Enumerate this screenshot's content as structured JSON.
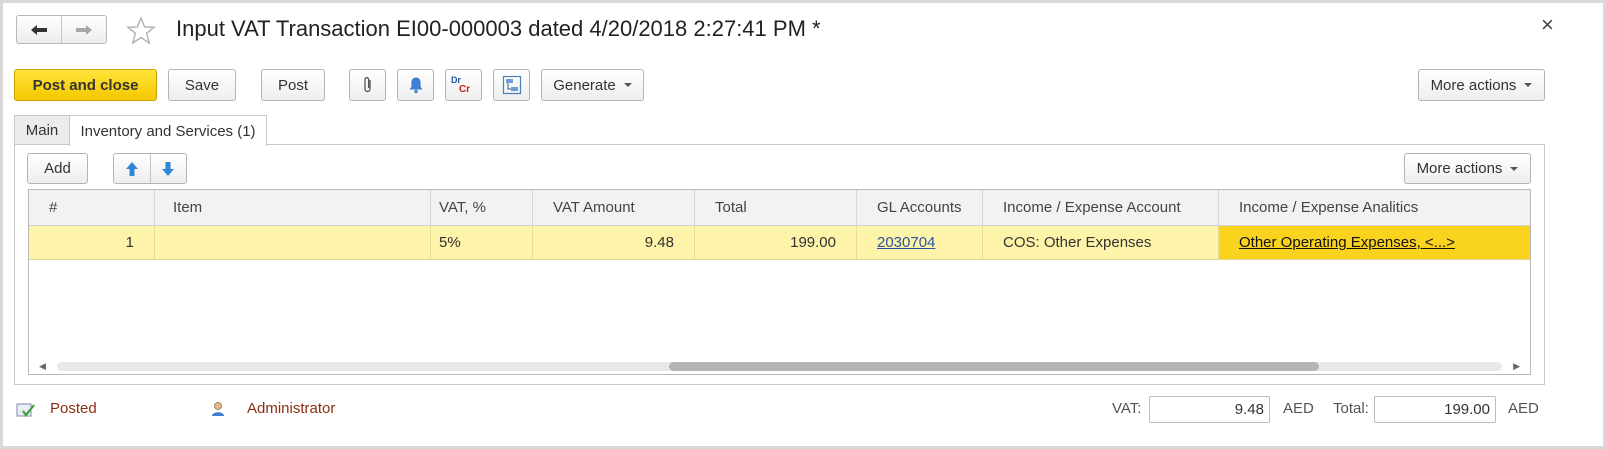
{
  "window": {
    "title": "Input VAT Transaction EI00-000003 dated 4/20/2018 2:27:41 PM *",
    "close_symbol": "×"
  },
  "toolbar": {
    "post_and_close": "Post and close",
    "save": "Save",
    "post": "Post",
    "generate": "Generate",
    "more_actions": "More actions",
    "dr_label": "Dr",
    "cr_label": "Cr"
  },
  "tabs": [
    {
      "label": "Main"
    },
    {
      "label": "Inventory and Services (1)"
    }
  ],
  "table_toolbar": {
    "add": "Add",
    "more_actions": "More actions"
  },
  "table": {
    "columns": [
      "#",
      "Item",
      "VAT, %",
      "VAT Amount",
      "Total",
      "GL Accounts",
      "Income / Expense Account",
      "Income / Expense Analitics"
    ],
    "rows": [
      {
        "num": "1",
        "item": "",
        "vat_rate": "5%",
        "vat_amount": "9.48",
        "total": "199.00",
        "gl_account": "2030704",
        "income_expense_account": "COS: Other Expenses",
        "income_expense_analytics": "Other Operating Expenses, <...>"
      }
    ],
    "scroll_position": 0.77
  },
  "footer": {
    "status": "Posted",
    "user": "Administrator",
    "vat_label": "VAT:",
    "vat_value": "9.48",
    "vat_currency": "AED",
    "total_label": "Total:",
    "total_value": "199.00",
    "total_currency": "AED"
  },
  "colors": {
    "accent_yellow": "#f5c800",
    "row_highlight": "#fdf3a9",
    "link_blue": "#2a55a2",
    "status_brown": "#8b2e0f"
  }
}
